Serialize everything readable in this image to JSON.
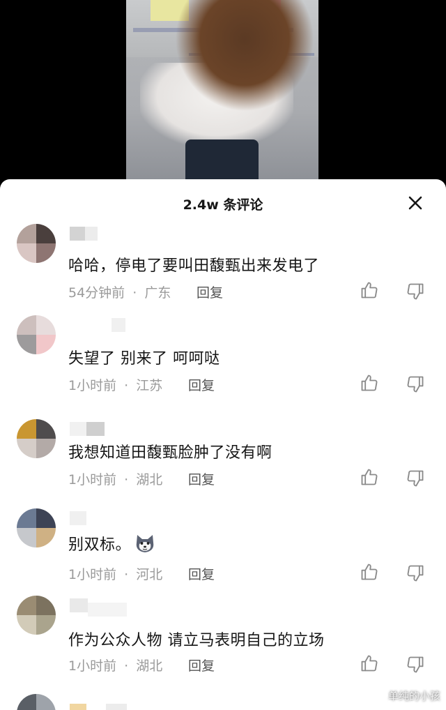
{
  "panel": {
    "title": "2.4w 条评论"
  },
  "comments": [
    {
      "text": "哈哈，停电了要叫田馥甄出来发电了",
      "time": "54分钟前",
      "location": "广东",
      "reply_label": "回复"
    },
    {
      "text": "失望了  别来了  呵呵哒",
      "time": "1小时前",
      "location": "江苏",
      "reply_label": "回复"
    },
    {
      "text": "我想知道田馥甄脸肿了没有啊",
      "time": "1小时前",
      "location": "湖北",
      "reply_label": "回复"
    },
    {
      "text": "别双标。",
      "time": "1小时前",
      "location": "河北",
      "reply_label": "回复"
    },
    {
      "text": "作为公众人物 请立马表明自己的立场",
      "time": "1小时前",
      "location": "湖北",
      "reply_label": "回复"
    }
  ],
  "meta_separator": "·",
  "icons": {
    "close": "close-icon",
    "like": "thumbs-up-icon",
    "dislike": "thumbs-down-icon",
    "emoji": "husky-dog-emoji-icon"
  },
  "watermark": "单纯的小孩"
}
